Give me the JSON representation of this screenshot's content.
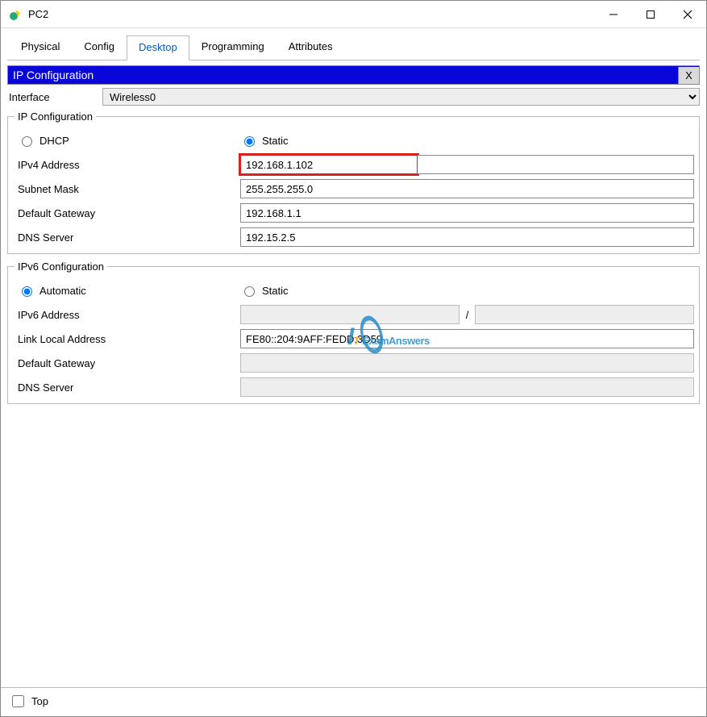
{
  "window": {
    "title": "PC2"
  },
  "tabs": {
    "physical": "Physical",
    "config": "Config",
    "desktop": "Desktop",
    "programming": "Programming",
    "attributes": "Attributes"
  },
  "panel": {
    "title": "IP Configuration",
    "close": "X"
  },
  "interface": {
    "label": "Interface",
    "selected": "Wireless0"
  },
  "ipv4": {
    "legend": "IP Configuration",
    "dhcp": "DHCP",
    "static": "Static",
    "addr_label": "IPv4 Address",
    "addr_value": "192.168.1.102",
    "mask_label": "Subnet Mask",
    "mask_value": "255.255.255.0",
    "gw_label": "Default Gateway",
    "gw_value": "192.168.1.1",
    "dns_label": "DNS Server",
    "dns_value": "192.15.2.5"
  },
  "ipv6": {
    "legend": "IPv6 Configuration",
    "auto": "Automatic",
    "static": "Static",
    "addr_label": "IPv6 Address",
    "addr_value": "",
    "ll_label": "Link Local Address",
    "ll_value": "FE80::204:9AFF:FEDD:3D59",
    "gw_label": "Default Gateway",
    "gw_value": "",
    "dns_label": "DNS Server",
    "dns_value": ""
  },
  "footer": {
    "top": "Top"
  },
  "watermark": {
    "text": "ITExamAnswers"
  }
}
